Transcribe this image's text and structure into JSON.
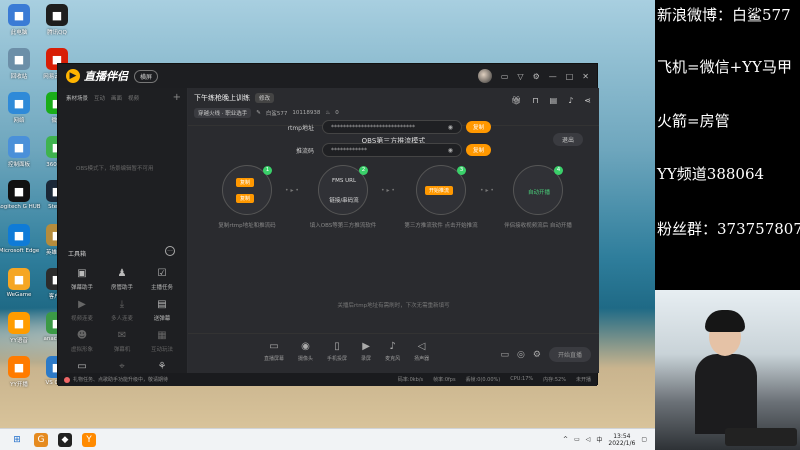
{
  "desktop": {
    "col1": [
      {
        "label": "此电脑",
        "icon": "computer-icon",
        "color": "#3a7bd5"
      },
      {
        "label": "回收站",
        "icon": "recycle-bin-icon",
        "color": "#6c8fa8"
      },
      {
        "label": "网络",
        "icon": "network-icon",
        "color": "#2f8ad8"
      },
      {
        "label": "控制面板",
        "icon": "control-panel-icon",
        "color": "#4a90d9"
      },
      {
        "label": "Logitech G HUB",
        "icon": "logitech-icon",
        "color": "#111111"
      },
      {
        "label": "Microsoft Edge",
        "icon": "edge-icon",
        "color": "#0f7bd7"
      },
      {
        "label": "WeGame",
        "icon": "wegame-icon",
        "color": "#f5a623"
      },
      {
        "label": "YY语音",
        "icon": "yy-icon",
        "color": "#ff9c00"
      },
      {
        "label": "YY开播",
        "icon": "yy-live-icon",
        "color": "#ff7b00"
      }
    ],
    "col2": [
      {
        "label": "腾讯QQ",
        "icon": "qq-icon",
        "color": "#1e1e1e"
      },
      {
        "label": "网易云音乐",
        "icon": "music-icon",
        "color": "#d81e06"
      },
      {
        "label": "微信",
        "icon": "wechat-icon",
        "color": "#1aad19"
      },
      {
        "label": "360安全",
        "icon": "shield-icon",
        "color": "#3fb34f"
      },
      {
        "label": "Steam",
        "icon": "steam-icon",
        "color": "#1b2838"
      },
      {
        "label": "英雄联盟",
        "icon": "lol-icon",
        "color": "#b58c3c"
      },
      {
        "label": "客户端",
        "icon": "app-icon",
        "color": "#2c2c2c"
      },
      {
        "label": "anaconda",
        "icon": "snake-icon",
        "color": "#3b9a46"
      },
      {
        "label": "VS Code",
        "icon": "code-icon",
        "color": "#2d7ac7"
      }
    ]
  },
  "side_panel": {
    "lines": [
      "新浪微博：白鲨577",
      "飞机=微信+YY马甲",
      "火箭=房管",
      "YY频道388064",
      "粉丝群：373757807"
    ]
  },
  "app": {
    "logo_text": "直播伴侣",
    "mode_label": "横屏",
    "left_tabs": [
      "素材场景",
      "互动",
      "画面",
      "视频"
    ],
    "left_note": "OBS模式下，场景编辑暂不可用",
    "tools_title": "工具箱",
    "tools": [
      {
        "label": "弹幕助手",
        "icon": "chat-icon",
        "dim": false
      },
      {
        "label": "房管助手",
        "icon": "admin-icon",
        "dim": false
      },
      {
        "label": "主播任务",
        "icon": "task-icon",
        "dim": false
      },
      {
        "label": "视频连麦",
        "icon": "video-icon",
        "dim": true
      },
      {
        "label": "多人连麦",
        "icon": "download-icon",
        "dim": true
      },
      {
        "label": "送弹幕",
        "icon": "gift-icon",
        "dim": false
      },
      {
        "label": "虚拟形象",
        "icon": "avatar-icon",
        "dim": true
      },
      {
        "label": "弹幕机",
        "icon": "bullet-icon",
        "dim": true
      },
      {
        "label": "互动玩法",
        "icon": "grid-icon",
        "dim": true
      },
      {
        "label": "投屏",
        "icon": "cast-icon",
        "dim": false
      },
      {
        "label": "PK对战",
        "icon": "camera-icon",
        "dim": true
      },
      {
        "label": "更多",
        "icon": "more-icon",
        "dim": false
      }
    ],
    "bottom_note": "礼物任务、点歌助手功能升级中，敬请期待",
    "bottom_stats": [
      "码率:0kb/s",
      "帧率:0fps",
      "丢帧:0(0.00%)",
      "CPU:17%",
      "内存:52%",
      "未开播"
    ],
    "room_title": "下午练枪晚上训练",
    "edit_label": "修改",
    "room_category": "穿越火线 · 职业选手",
    "room_id": "白鲨577",
    "fans": "10118938",
    "heat": "0",
    "obs_title": "OBS第三方推流模式",
    "exit_label": "退出",
    "steps": [
      {
        "num": "1",
        "chip_a": "复制",
        "chip_b": "复制",
        "caption": "复制rtmp地址和推流码"
      },
      {
        "num": "2",
        "top_text": "FMS URL",
        "bottom_text": "链接/串码流",
        "caption": "填入OBS等第三方推流软件"
      },
      {
        "num": "3",
        "chip_a": "开始推流",
        "caption": "第三方推流软件 点击开始推流"
      },
      {
        "num": "4",
        "green_text": "自动开播",
        "caption": "伴侣接收视频流后 自动开播"
      }
    ],
    "rtmp_label": "rtmp地址",
    "rtmp_value": "****************************",
    "stream_label": "推流码",
    "stream_value": "************",
    "copy_label": "复制",
    "hint": "关播后rtmp地址有需刷时，下次无需重新填写",
    "footer_tools": [
      {
        "label": "直播屏幕",
        "icon": "screen-icon"
      },
      {
        "label": "摄像头",
        "icon": "webcam-icon"
      },
      {
        "label": "手机投屏",
        "icon": "phone-icon"
      },
      {
        "label": "录屏",
        "icon": "record-icon"
      },
      {
        "label": "麦克风",
        "icon": "mic-icon"
      },
      {
        "label": "扬声器",
        "icon": "speaker-icon"
      }
    ],
    "live_label": "开始直播"
  },
  "taskbar": {
    "time": "13:54",
    "date": "2022/1/6"
  }
}
